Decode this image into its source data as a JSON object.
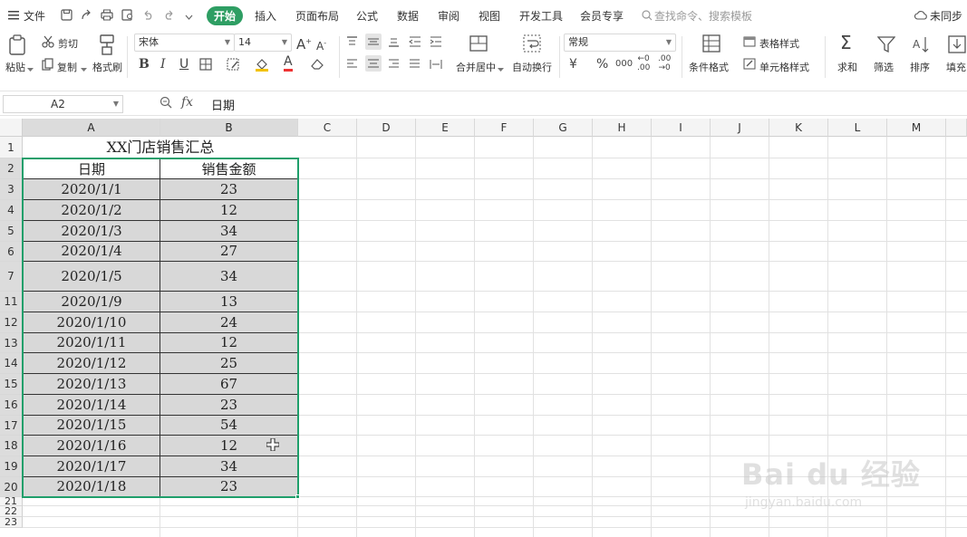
{
  "menubar": {
    "file_label": "文件",
    "tabs": [
      "开始",
      "插入",
      "页面布局",
      "公式",
      "数据",
      "审阅",
      "视图",
      "开发工具",
      "会员专享"
    ],
    "active_tab": "开始",
    "search_placeholder": "查找命令、搜索模板",
    "sync_label": "未同步"
  },
  "ribbon": {
    "paste_label": "粘贴",
    "cut_label": "剪切",
    "copy_label": "复制",
    "format_painter_label": "格式刷",
    "font_name": "宋体",
    "font_size": "14",
    "number_format": "常规",
    "merge_label": "合并居中",
    "wrap_label": "自动换行",
    "cond_format_label": "条件格式",
    "table_style_label": "表格样式",
    "cell_style_label": "单元格样式",
    "sum_label": "求和",
    "filter_label": "筛选",
    "sort_label": "排序",
    "fill_label": "填充",
    "currency_symbol": "¥",
    "percent_symbol": "%",
    "thousands_symbol": "000"
  },
  "formula_bar": {
    "name_box": "A2",
    "fx": "fx",
    "content": "日期"
  },
  "sheet": {
    "columns": [
      "A",
      "B",
      "C",
      "D",
      "E",
      "F",
      "G",
      "H",
      "I",
      "J",
      "K",
      "L",
      "M"
    ],
    "title": "XX门店销售汇总",
    "header": [
      "日期",
      "销售金额"
    ],
    "rows": [
      {
        "row": "1"
      },
      {
        "row": "2"
      },
      {
        "row": "3",
        "date": "2020/1/1",
        "amount": "23"
      },
      {
        "row": "4",
        "date": "2020/1/2",
        "amount": "12"
      },
      {
        "row": "5",
        "date": "2020/1/3",
        "amount": "34"
      },
      {
        "row": "6",
        "date": "2020/1/4",
        "amount": "27"
      },
      {
        "row": "7",
        "date": "2020/1/5",
        "amount": "34"
      },
      {
        "row": "11",
        "date": "2020/1/9",
        "amount": "13"
      },
      {
        "row": "12",
        "date": "2020/1/10",
        "amount": "24"
      },
      {
        "row": "13",
        "date": "2020/1/11",
        "amount": "12"
      },
      {
        "row": "14",
        "date": "2020/1/12",
        "amount": "25"
      },
      {
        "row": "15",
        "date": "2020/1/13",
        "amount": "67"
      },
      {
        "row": "16",
        "date": "2020/1/14",
        "amount": "23"
      },
      {
        "row": "17",
        "date": "2020/1/15",
        "amount": "54"
      },
      {
        "row": "18",
        "date": "2020/1/16",
        "amount": "12"
      },
      {
        "row": "19",
        "date": "2020/1/17",
        "amount": "34"
      },
      {
        "row": "20",
        "date": "2020/1/18",
        "amount": "23"
      },
      {
        "row": "21"
      },
      {
        "row": "22"
      },
      {
        "row": "23"
      }
    ],
    "selected_columns": [
      "A",
      "B"
    ]
  },
  "watermark": {
    "main": "Bai du 经验",
    "sub": "jingyan.baidu.com"
  },
  "colors": {
    "accent_green": "#2e9e63",
    "selection_border": "#1f9f6b",
    "data_fill": "#d8d8d8"
  }
}
